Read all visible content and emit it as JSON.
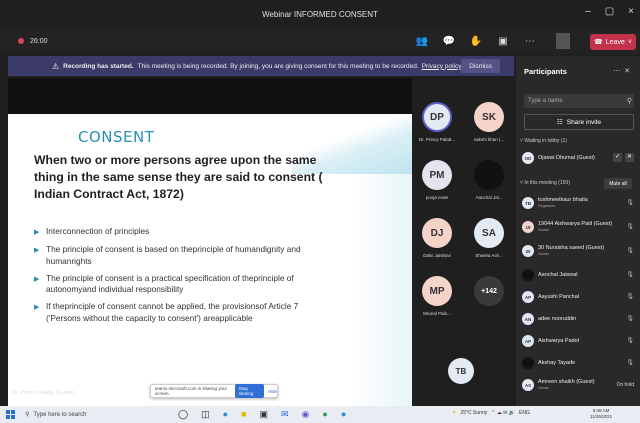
{
  "window": {
    "title": "Webinar INFORMED CONSENT",
    "controls": [
      "–",
      "▢",
      "×"
    ]
  },
  "meeting": {
    "timer": "26:00",
    "toolbar_icons": [
      "people-icon",
      "chat-icon",
      "hand-icon",
      "rooms-icon",
      "more-icon",
      "camera-icon",
      "mic-icon",
      "share-icon"
    ],
    "leave_label": "Leave"
  },
  "banner": {
    "bold": "Recording has started.",
    "text": "This meeting is being recorded. By joining, you are giving consent for this meeting to be recorded.",
    "link": "Privacy policy",
    "dismiss": "Dismiss"
  },
  "slide": {
    "title": "CONSENT",
    "heading": "When two or more persons agree upon the same thing in the same sense they are said to consent ( Indian Contract Act, 1872)",
    "bullets": [
      "Interconnection of principles",
      "The principle of consent is based on theprinciple of humandignity and humanrights",
      "The principle of consent is a practical specification of theprinciple of autonomyand individual responsibility",
      "If theprinciple of consent cannot be applied, the provisionsof Article 7 ('Persons without the capacity to consent') areapplicable"
    ],
    "share_text": "teams.microsoft.com is sharing your screen.",
    "stop_sharing": "Stop sharing",
    "hide": "Hide"
  },
  "presenter": "Dr. Princy Palatty (Guest)",
  "tiles": [
    {
      "initials": "DP",
      "name": "Dr. Princy Palatt...",
      "color": "#e4eaf3"
    },
    {
      "initials": "SK",
      "name": "sakshi khan (...",
      "color": "#f4d3c9"
    },
    {
      "initials": "PM",
      "name": "pooja mote",
      "color": "#e4e4ef"
    },
    {
      "initials": "",
      "name": "Aanchal Jai...",
      "color": "#111111"
    },
    {
      "initials": "DJ",
      "name": "Dalvi Jaishavi",
      "color": "#f4d3c9"
    },
    {
      "initials": "SA",
      "name": "Shweta Ach...",
      "color": "#e4eaf3"
    },
    {
      "initials": "MP",
      "name": "Mrunal Palo...",
      "color": "#f4d3c9"
    },
    {
      "initials": "+142",
      "name": "",
      "color": "#3a3a3a"
    }
  ],
  "self_tile": "TB",
  "participants": {
    "title": "Participants",
    "search_placeholder": "Type a name",
    "share_invite": "Share invite",
    "lobby_label": "Waiting in lobby (1)",
    "in_meeting_label": "In this meeting (150)",
    "mute_all": "Mute all",
    "lobby": [
      {
        "initials": "OD",
        "name": "Ojaswi Dhumal (Guest)",
        "color": "#e4eaf3"
      }
    ],
    "people": [
      {
        "initials": "TB",
        "name": "tushmeetkaur bhatia",
        "role": "Organizer",
        "color": "#e4eaf3"
      },
      {
        "initials": "19",
        "name": "19044 Aishwarya Patil (Guest)",
        "role": "Guest",
        "color": "#f4d3c9"
      },
      {
        "initials": "30",
        "name": "30 Nuraisha saeed (Guest)",
        "role": "Guest",
        "color": "#e4eaf3"
      },
      {
        "initials": "",
        "name": "Aanchal Jaiswal",
        "role": "",
        "color": "#111111"
      },
      {
        "initials": "AP",
        "name": "Aayushi Panchal",
        "role": "",
        "color": "#dfe6f3"
      },
      {
        "initials": "AN",
        "name": "adee nooruddin",
        "role": "",
        "color": "#e8e0f3"
      },
      {
        "initials": "AP",
        "name": "Aishwarya Padol",
        "role": "",
        "color": "#dfe6f3"
      },
      {
        "initials": "",
        "name": "Akshay Tayade",
        "role": "",
        "color": "#111111"
      },
      {
        "initials": "AS",
        "name": "Amreen shaikh (Guest)",
        "role": "Guest",
        "color": "#e4eaf3",
        "status": "On hold"
      }
    ]
  },
  "taskbar": {
    "search": "Type here to search",
    "weather": "25°C Sunny",
    "lang": "ENG",
    "time": "9:48 AM",
    "date": "11/26/2021"
  }
}
